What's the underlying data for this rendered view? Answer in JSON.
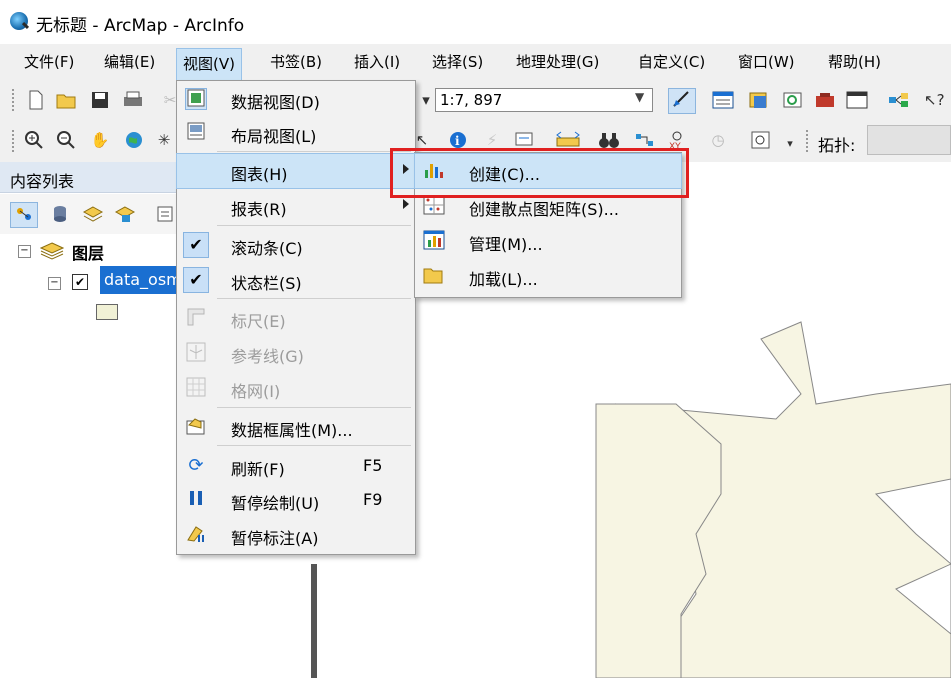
{
  "window": {
    "title": "无标题 - ArcMap - ArcInfo"
  },
  "menubar": {
    "items": [
      "文件(F)",
      "编辑(E)",
      "视图(V)",
      "书签(B)",
      "插入(I)",
      "选择(S)",
      "地理处理(G)",
      "自定义(C)",
      "窗口(W)",
      "帮助(H)"
    ]
  },
  "toolbar": {
    "scale_value": "1:7, 897",
    "topology_label": "拓扑:"
  },
  "toc": {
    "title": "内容列表",
    "root_label": "图层",
    "layer_name": "data_osm"
  },
  "view_menu": {
    "items": [
      {
        "label": "数据视图(D)",
        "icon": "data-view-icon"
      },
      {
        "label": "布局视图(L)",
        "icon": "layout-view-icon"
      },
      {
        "label": "图表(H)",
        "icon": ""
      },
      {
        "label": "报表(R)",
        "icon": ""
      },
      {
        "label": "滚动条(C)",
        "icon": "check-icon"
      },
      {
        "label": "状态栏(S)",
        "icon": "check-icon"
      },
      {
        "label": "标尺(E)",
        "icon": "ruler-icon",
        "disabled": true
      },
      {
        "label": "参考线(G)",
        "icon": "guides-icon",
        "disabled": true
      },
      {
        "label": "格网(I)",
        "icon": "grid-icon",
        "disabled": true
      },
      {
        "label": "数据框属性(M)...",
        "icon": "data-frame-properties-icon"
      },
      {
        "label": "刷新(F)",
        "shortcut": "F5",
        "icon": "refresh-icon"
      },
      {
        "label": "暂停绘制(U)",
        "shortcut": "F9",
        "icon": "pause-icon"
      },
      {
        "label": "暂停标注(A)",
        "icon": "pause-labeling-icon"
      }
    ]
  },
  "graph_submenu": {
    "items": [
      {
        "label": "创建(C)...",
        "icon": "bar-chart-icon"
      },
      {
        "label": "创建散点图矩阵(S)...",
        "icon": "scatter-matrix-icon"
      },
      {
        "label": "管理(M)...",
        "icon": "manage-graphs-icon"
      },
      {
        "label": "加载(L)...",
        "icon": "folder-open-icon"
      }
    ]
  },
  "colors": {
    "highlight": "#cce4f7",
    "selection": "#1a6fd1",
    "polygon_fill": "#f5f5dc",
    "annotation": "#e02020"
  }
}
